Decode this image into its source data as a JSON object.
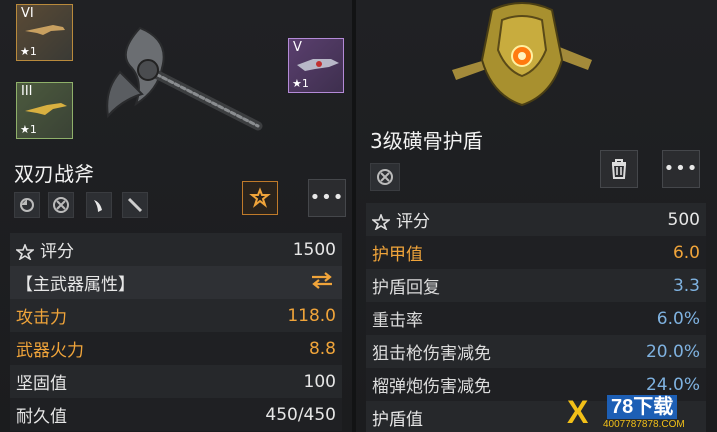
{
  "left": {
    "slots": [
      {
        "tier": "VI",
        "stars": "★1"
      },
      {
        "tier": "III",
        "stars": "★1"
      },
      {
        "tier": "V",
        "stars": "★1"
      }
    ],
    "title": "双刃战斧",
    "rows": [
      {
        "label": "评分",
        "value": "1500",
        "style": "normal"
      },
      {
        "label": "【主武器属性】",
        "value": "",
        "style": "title"
      },
      {
        "label": "攻击力",
        "value": "118.0",
        "style": "orange"
      },
      {
        "label": "武器火力",
        "value": "8.8",
        "style": "orange"
      },
      {
        "label": "坚固值",
        "value": "100",
        "style": "normal"
      },
      {
        "label": "耐久值",
        "value": "450/450",
        "style": "normal"
      }
    ]
  },
  "right": {
    "title": "3级磺骨护盾",
    "rows": [
      {
        "label": "评分",
        "value": "500",
        "style": "normal"
      },
      {
        "label": "护甲值",
        "value": "6.0",
        "style": "orange"
      },
      {
        "label": "护盾回复",
        "value": "3.3",
        "style": "blue"
      },
      {
        "label": "重击率",
        "value": "6.0%",
        "style": "blue"
      },
      {
        "label": "狙击枪伤害减免",
        "value": "20.0%",
        "style": "blue"
      },
      {
        "label": "榴弹炮伤害减免",
        "value": "24.0%",
        "style": "blue"
      },
      {
        "label": "护盾值",
        "value": "",
        "style": "normal"
      }
    ]
  },
  "more_label": "•••",
  "watermark": {
    "mark": "X",
    "main": "78下载",
    "sub": "4007787878.COM"
  }
}
